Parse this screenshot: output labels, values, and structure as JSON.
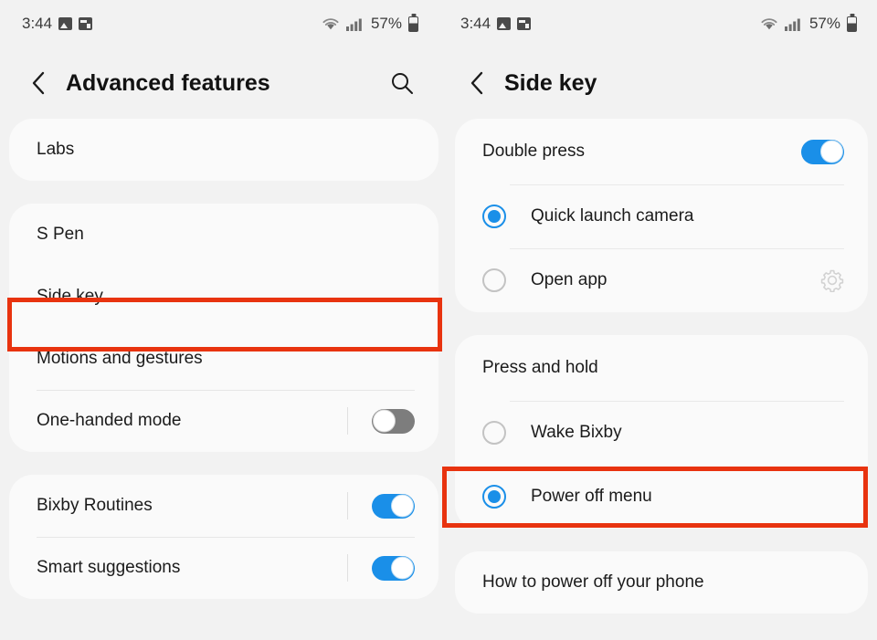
{
  "colors": {
    "accent_blue": "#1a8fe8",
    "highlight_red": "#e8330f",
    "toggle_off_gray": "#7d7d7d",
    "panel_bg": "#f2f2f2",
    "card_bg": "#fafafa"
  },
  "left_panel": {
    "status_bar": {
      "time": "3:44",
      "battery_percent": "57%",
      "icons": [
        "photo-icon",
        "screenshot-icon",
        "wifi-icon",
        "signal-icon",
        "battery-icon"
      ]
    },
    "appbar": {
      "back_label": "‹",
      "title": "Advanced features",
      "search_label": "search-icon"
    },
    "cards": [
      {
        "rows": [
          {
            "type": "nav",
            "label": "Labs"
          }
        ]
      },
      {
        "rows": [
          {
            "type": "nav",
            "label": "S Pen"
          },
          {
            "type": "nav",
            "label": "Side key",
            "highlighted": true
          },
          {
            "type": "nav",
            "label": "Motions and gestures"
          },
          {
            "type": "toggle",
            "label": "One-handed mode",
            "state": "off"
          }
        ]
      },
      {
        "rows": [
          {
            "type": "toggle",
            "label": "Bixby Routines",
            "state": "on"
          },
          {
            "type": "toggle",
            "label": "Smart suggestions",
            "state": "on"
          }
        ]
      }
    ]
  },
  "right_panel": {
    "status_bar": {
      "time": "3:44",
      "battery_percent": "57%",
      "icons": [
        "photo-icon",
        "screenshot-icon",
        "wifi-icon",
        "signal-icon",
        "battery-icon"
      ]
    },
    "appbar": {
      "back_label": "‹",
      "title": "Side key"
    },
    "sections": [
      {
        "header": {
          "label": "Double press",
          "toggle": "on"
        },
        "options": [
          {
            "label": "Quick launch camera",
            "selected": true
          },
          {
            "label": "Open app",
            "selected": false,
            "settings_icon": "gear-icon"
          }
        ]
      },
      {
        "header": {
          "label": "Press and hold"
        },
        "options": [
          {
            "label": "Wake Bixby",
            "selected": false
          },
          {
            "label": "Power off menu",
            "selected": true,
            "highlighted": true
          }
        ]
      }
    ],
    "footer_card": {
      "label": "How to power off your phone"
    }
  }
}
